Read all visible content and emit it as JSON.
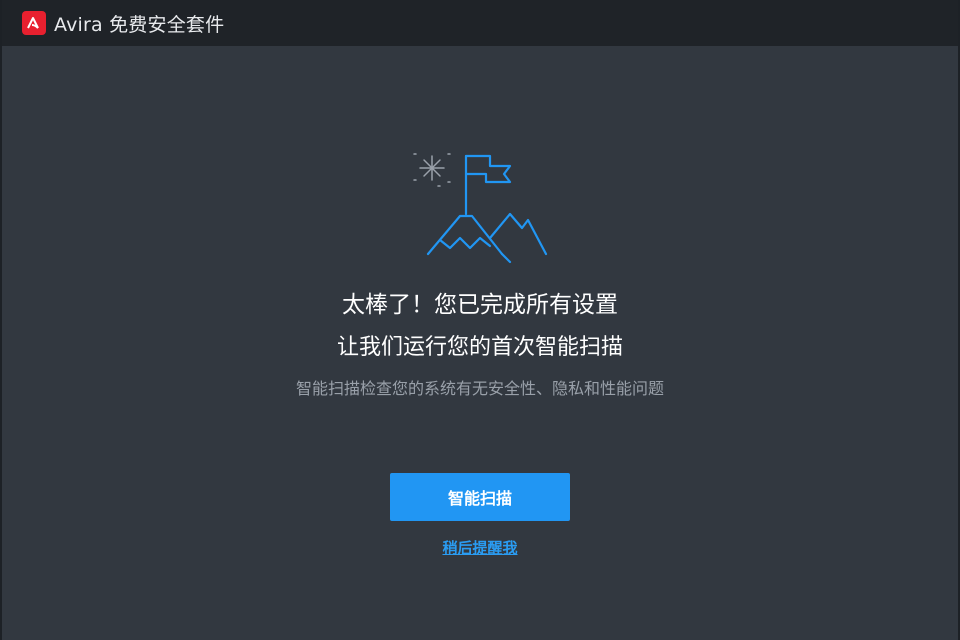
{
  "window": {
    "app_title": "Avira 免费安全套件"
  },
  "main": {
    "heading": "太棒了！您已完成所有设置",
    "subheading": "让我们运行您的首次智能扫描",
    "description": "智能扫描检查您的系统有无安全性、隐私和性能问题",
    "scan_button_label": "智能扫描",
    "remind_later_link": "稍后提醒我"
  },
  "icons": {
    "logo": "avira-logo-icon",
    "illustration": "mountain-flag-fireworks-icon"
  },
  "colors": {
    "brand_red": "#e8202f",
    "accent_blue": "#2196f3",
    "background": "#323840",
    "titlebar": "#1f2328"
  }
}
